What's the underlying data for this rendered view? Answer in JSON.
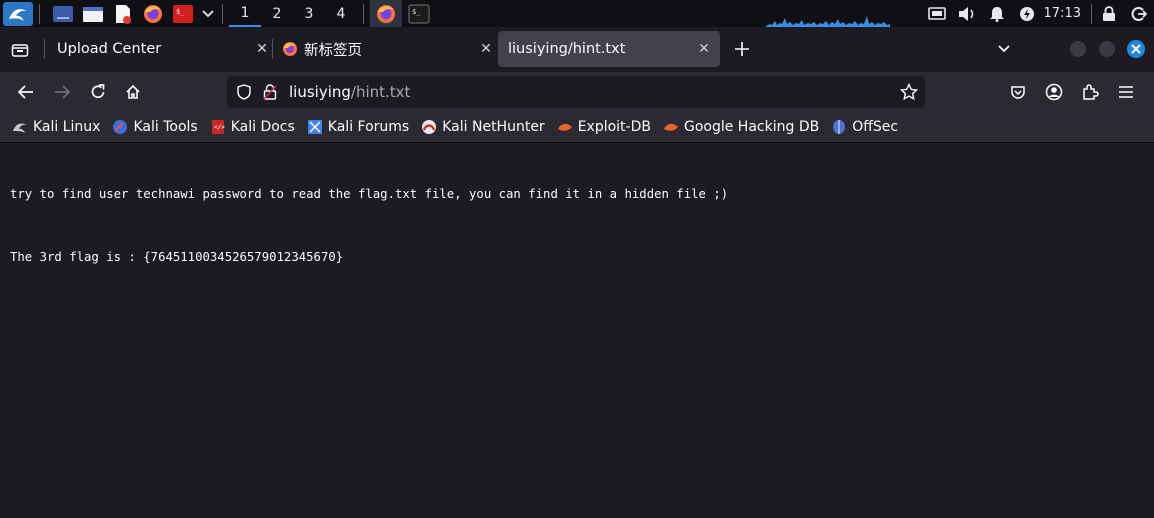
{
  "taskbar": {
    "workspaces": [
      "1",
      "2",
      "3",
      "4"
    ],
    "active_workspace": "1",
    "clock": "17:13",
    "icons": [
      "kali-menu-icon",
      "workspace-app-icon",
      "file-manager-icon",
      "text-editor-icon",
      "firefox-icon",
      "terminal-root-icon",
      "chevron-down-icon"
    ],
    "window_icons": [
      "firefox-icon",
      "terminal-icon"
    ],
    "tray": [
      "display-icon",
      "volume-icon",
      "notification-bell-icon",
      "power-icon",
      "lock-icon",
      "logout-icon"
    ]
  },
  "tabs": [
    {
      "title": "Upload Center",
      "active": false,
      "icon": "none"
    },
    {
      "title": "新标签页",
      "active": false,
      "icon": "firefox-icon"
    },
    {
      "title": "liusiying/hint.txt",
      "active": true,
      "icon": "none"
    }
  ],
  "urlbar": {
    "host": "liusiying",
    "path": "/hint.txt"
  },
  "bookmarks": [
    {
      "label": "Kali Linux",
      "icon": "kali-dragon-icon"
    },
    {
      "label": "Kali Tools",
      "icon": "kali-tools-icon"
    },
    {
      "label": "Kali Docs",
      "icon": "kali-docs-icon"
    },
    {
      "label": "Kali Forums",
      "icon": "kali-forums-icon"
    },
    {
      "label": "Kali NetHunter",
      "icon": "nethunter-icon"
    },
    {
      "label": "Exploit-DB",
      "icon": "exploit-db-icon"
    },
    {
      "label": "Google Hacking DB",
      "icon": "ghdb-icon"
    },
    {
      "label": "OffSec",
      "icon": "offsec-icon"
    }
  ],
  "content": {
    "line1": "try to find user technawi password to read the flag.txt file, you can find it in a hidden file ;)",
    "line2": "The 3rd flag is : {7645110034526579012345670}"
  },
  "colors": {
    "accent": "#1e88e5",
    "tab_active_bg": "#42414d",
    "toolbar_bg": "#2b2a33",
    "page_bg": "#1c1b22",
    "taskbar_bg": "#0e1014"
  }
}
